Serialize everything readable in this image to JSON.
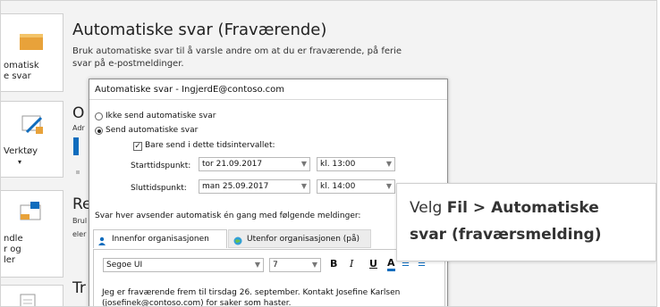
{
  "sidebar": {
    "tiles": [
      {
        "label_1": "omatisk",
        "label_2": "e svar"
      },
      {
        "label_1": "Verktøy",
        "label_2": "▾"
      },
      {
        "label_1": "ndle",
        "label_2": "r og",
        "label_3": "ler"
      },
      {
        "label_1": ""
      }
    ]
  },
  "section_auto": {
    "title": "Automatiske svar (Fraværende)",
    "desc_1": "Bruk automatiske svar til å varsle andre om at du er fraværende, på ferie",
    "desc_2": "svar på e-postmeldinger."
  },
  "section_o": {
    "title": "O",
    "desc": "Adr"
  },
  "section_re": {
    "title": "Re",
    "desc_1": "Brul",
    "desc_2": "eler"
  },
  "section_tr": {
    "title": "Tr"
  },
  "dialog": {
    "title": "Automatiske svar - IngjerdE@contoso.com",
    "radio_off": "Ikke send automatiske svar",
    "radio_on": "Send automatiske svar",
    "check_range": "Bare send i dette tidsintervallet:",
    "start_label": "Starttidspunkt:",
    "start_date": "tor 21.09.2017",
    "start_time": "kl. 13:00",
    "end_label": "Sluttidspunkt:",
    "end_date": "man 25.09.2017",
    "end_time": "kl. 14:00",
    "once_text": "Svar hver avsender automatisk én gang med følgende meldinger:",
    "tab_inside": "Innenfor organisasjonen",
    "tab_outside": "Utenfor organisasjonen (på)",
    "font_name": "Segoe UI",
    "font_size": "7",
    "bold": "B",
    "italic": "I",
    "underline": "U",
    "font_color": "A",
    "message_1": "Jeg er fraværende frem til tirsdag 26. september. Kontakt Josefine Karlsen",
    "message_2": "(josefinek@contoso.com) for saker som haster."
  },
  "callout": {
    "line1_prefix": "Velg ",
    "line1_bold_1": "Fil",
    "line1_sep": " > ",
    "line1_bold_2": "Automatiske",
    "line2_bold": "svar (fraværsmelding)"
  },
  "colors": {
    "accent": "#0f6cbd",
    "icon_orange": "#e8a23a"
  }
}
